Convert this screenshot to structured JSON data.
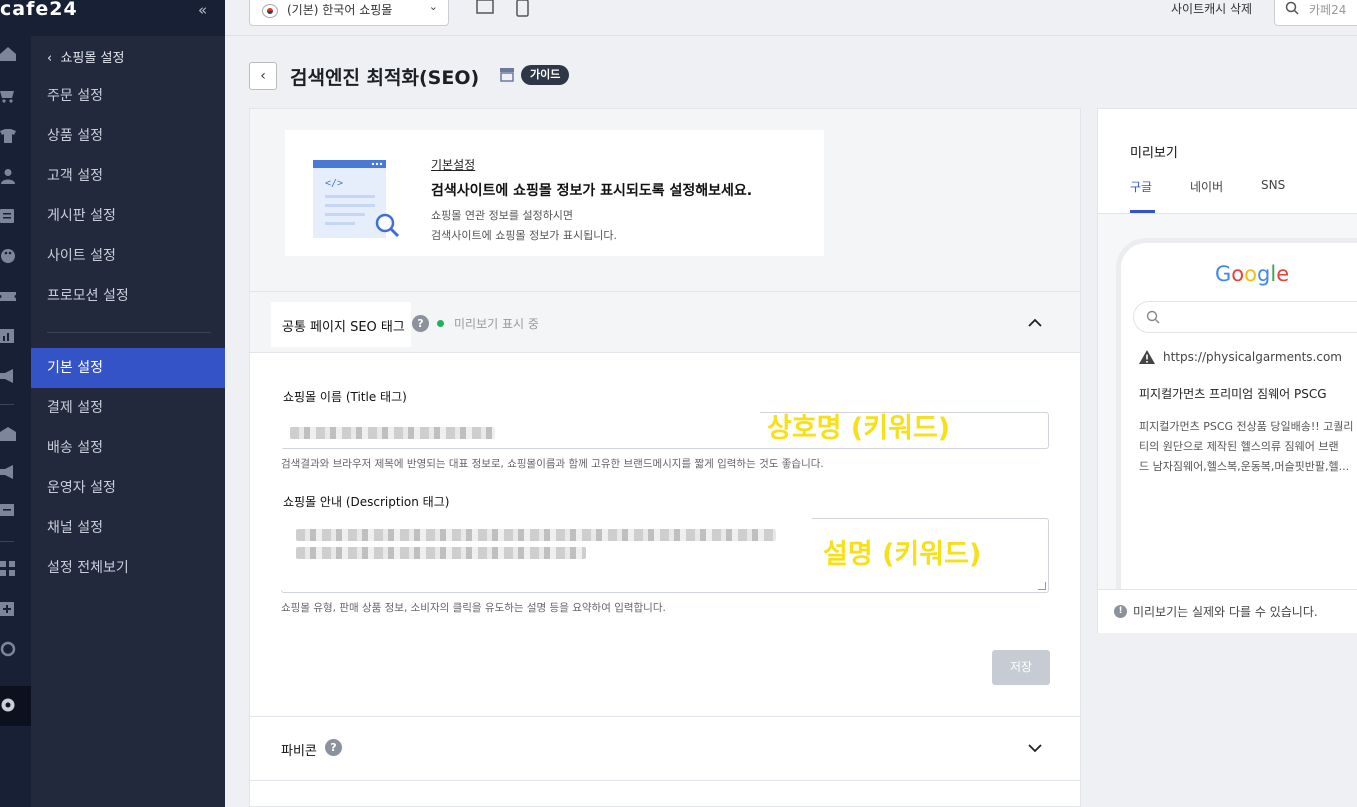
{
  "app": {
    "logo": "cafe24",
    "collapse_icon": "«"
  },
  "topbar": {
    "mall_select": "(기본) 한국어 쇼핑몰",
    "cache_delete": "사이트캐시 삭제",
    "search_placeholder": "카페24"
  },
  "sidebar": {
    "back_label": "쇼핑몰 설정",
    "items": [
      {
        "label": "주문 설정"
      },
      {
        "label": "상품 설정"
      },
      {
        "label": "고객 설정"
      },
      {
        "label": "게시판 설정"
      },
      {
        "label": "사이트 설정"
      },
      {
        "label": "프로모션 설정"
      },
      {
        "label": "기본 설정",
        "active": true
      },
      {
        "label": "결제 설정"
      },
      {
        "label": "배송 설정"
      },
      {
        "label": "운영자 설정"
      },
      {
        "label": "채널 설정"
      },
      {
        "label": "설정 전체보기"
      }
    ]
  },
  "page": {
    "title": "검색엔진 최적화(SEO)",
    "guide_badge": "가이드"
  },
  "banner": {
    "link": "기본설정",
    "headline": "검색사이트에 쇼핑몰 정보가 표시되도록 설정해보세요.",
    "desc_line1": "쇼핑몰 연관 정보를 설정하시면",
    "desc_line2": "검색사이트에 쇼핑몰 정보가 표시됩니다.",
    "code_glyph": "</>"
  },
  "seo_section": {
    "title": "공통 페이지 SEO 태그",
    "help": "?",
    "status": "미리보기 표시 중",
    "title_field": {
      "label": "쇼핑몰 이름 (Title 태그)",
      "hint": "검색결과와 브라우저 제목에 반영되는 대표 정보로, 쇼핑몰이름과 함께 고유한 브랜드메시지를 짧게 입력하는 것도 좋습니다.",
      "annotation": "상호명 (키워드)"
    },
    "desc_field": {
      "label": "쇼핑몰 안내 (Description 태그)",
      "hint": "쇼핑몰 유형, 판매 상품 정보, 소비자의 클릭을 유도하는 설명 등을 요약하여 입력합니다.",
      "annotation": "설명 (키워드)"
    },
    "save_label": "저장"
  },
  "favicon_section": {
    "title": "파비콘",
    "help": "?"
  },
  "preview": {
    "title": "미리보기",
    "tabs": [
      "구글",
      "네이버",
      "SNS"
    ],
    "active_tab": "구글",
    "google": {
      "logo": "Google",
      "url": "https://physicalgarments.com",
      "result_title": "피지컬가먼츠 프리미엄 짐웨어 PSCG",
      "desc_lines": [
        "피지컬가먼츠 PSCG 전상품 당일배송!! 고퀄리",
        "티의 원단으로 제작된 헬스의류 짐웨어 브랜",
        "드 남자짐웨어,헬스복,운동복,머슬핏반팔,헬..."
      ]
    },
    "note": "미리보기는 실제와 다를 수 있습니다.",
    "info_icon": "!"
  },
  "colors": {
    "accent": "#3453c6",
    "sidebar_bg": "#22293d",
    "rail_bg": "#182036",
    "annotation": "#f7e018"
  }
}
